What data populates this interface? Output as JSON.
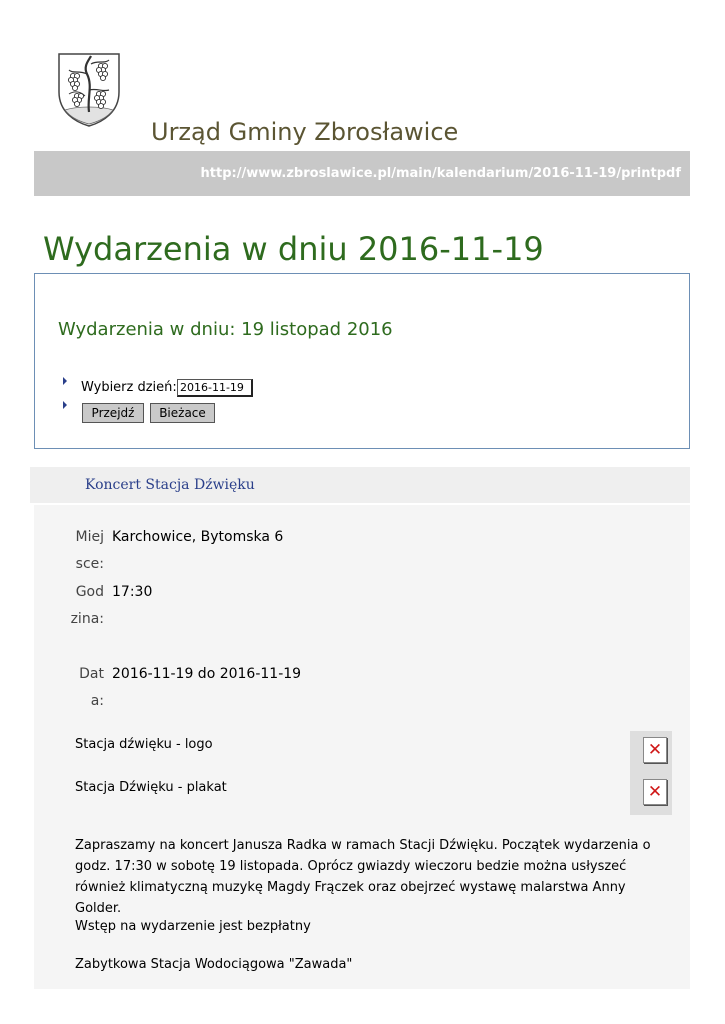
{
  "header": {
    "site_title": "Urząd Gminy Zbrosławice",
    "url": "http://www.zbroslawice.pl/main/kalendarium/2016-11-19/printpdf",
    "crest_icon": "coat-of-arms-grapevine"
  },
  "page_heading": "Wydarzenia w dniu 2016-11-19",
  "calendar_box": {
    "title": "Wydarzenia w dniu: 19 listopad 2016",
    "date_label": "Wybierz dzień:",
    "date_value": "2016-11-19",
    "go_button": "Przejdź",
    "today_button": "Bieżace"
  },
  "event": {
    "title": "Koncert Stacja Dźwięku",
    "fields": [
      {
        "label": "Miejsce:",
        "value": "Karchowice, Bytomska 6"
      },
      {
        "label": "Godzina:",
        "value": "17:30"
      },
      {
        "label": "Data:",
        "value": "2016-11-19 do 2016-11-19"
      }
    ],
    "attachments": [
      {
        "label": "Stacja dźwięku - logo",
        "icon": "broken-image-icon"
      },
      {
        "label": "Stacja Dźwięku - plakat",
        "icon": "broken-image-icon"
      }
    ],
    "paragraphs": [
      "Zapraszamy na koncert Janusza Radka w ramach Stacji Dźwięku. Początek wydarzenia o godz. 17:30 w sobotę 19 listopada. Oprócz gwiazdy wieczoru bedzie można usłyszeć również klimatyczną muzykę Magdy Frączek oraz obejrzeć wystawę malarstwa Anny Golder.",
      "Wstęp na wydarzenie jest bezpłatny",
      "Zabytkowa Stacja Wodociągowa \"Zawada\""
    ]
  },
  "colors": {
    "site_title": "#5b5533",
    "heading_green": "#2e6b1e",
    "url_bar": "#c8c8c8",
    "link_blue": "#2a3f8a",
    "broken_x": "#d01818"
  }
}
